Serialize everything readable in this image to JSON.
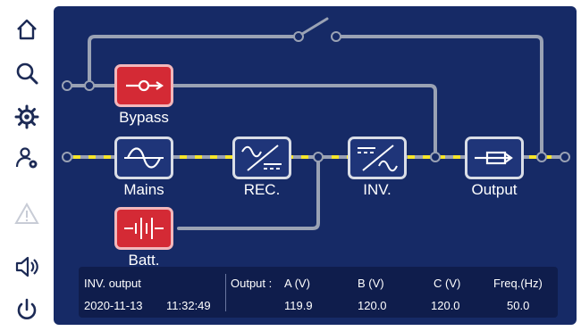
{
  "sidebar": {
    "items": [
      {
        "icon": "home-icon",
        "state": "enabled"
      },
      {
        "icon": "search-icon",
        "state": "enabled"
      },
      {
        "icon": "gear-icon",
        "state": "enabled"
      },
      {
        "icon": "user-settings-icon",
        "state": "enabled"
      },
      {
        "icon": "warning-icon",
        "state": "disabled"
      },
      {
        "icon": "speaker-icon",
        "state": "enabled"
      },
      {
        "icon": "power-icon",
        "state": "enabled"
      }
    ]
  },
  "diagram": {
    "blocks": {
      "bypass": {
        "label": "Bypass",
        "icon": "bypass-icon",
        "state": "alarm"
      },
      "mains": {
        "label": "Mains",
        "icon": "sine-wave-icon",
        "state": "normal"
      },
      "rectifier": {
        "label": "REC.",
        "icon": "rectifier-icon",
        "state": "normal"
      },
      "inverter": {
        "label": "INV.",
        "icon": "inverter-icon",
        "state": "normal"
      },
      "output": {
        "label": "Output",
        "icon": "output-arrow-icon",
        "state": "normal"
      },
      "battery": {
        "label": "Batt.",
        "icon": "battery-icon",
        "state": "alarm"
      }
    },
    "bypass_switch": "open",
    "active_path": "mains-rectifier-inverter-output"
  },
  "status": {
    "title": "INV. output",
    "date": "2020-11-13",
    "time": "11:32:49",
    "output_label": "Output :",
    "columns": [
      "A (V)",
      "B (V)",
      "C (V)",
      "Freq.(Hz)"
    ],
    "values": [
      "119.9",
      "120.0",
      "120.0",
      "50.0"
    ]
  },
  "colors": {
    "panel_bg": "#162a66",
    "status_bg": "#0f1d4c",
    "line_gray": "#9aa2b4",
    "flow_yellow": "#f6e529",
    "alarm_red": "#d42a35",
    "block_blue": "#1f3579"
  }
}
